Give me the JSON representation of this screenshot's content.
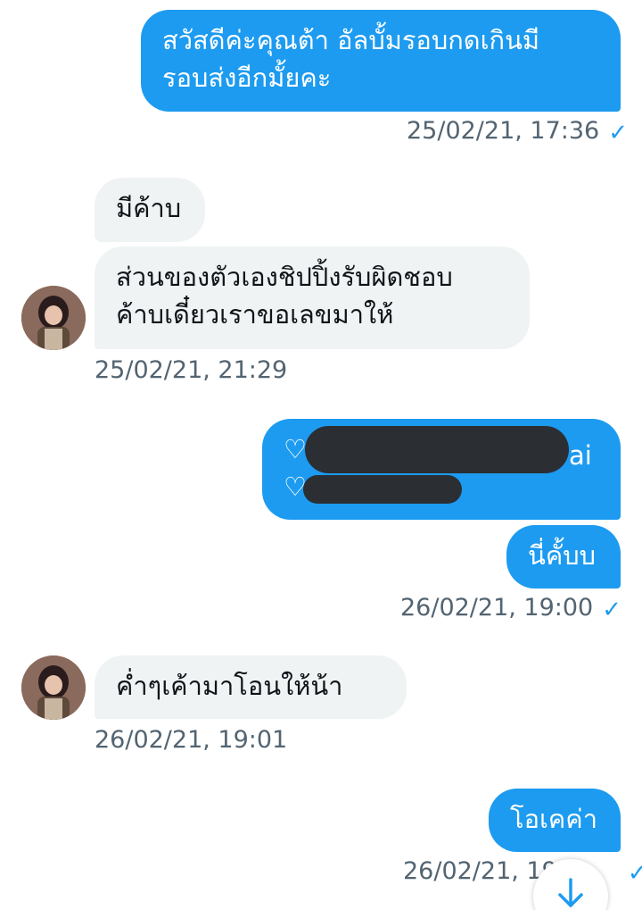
{
  "messages": [
    {
      "lines": [
        "สวัสดีค่ะคุณต้า อัลบั้มรอบกดเกินมี",
        "รอบส่งอีกมั้ยคะ"
      ],
      "meta": "25/02/21, 17:36"
    },
    {
      "lines": [
        "มีค้าบ"
      ]
    },
    {
      "lines": [
        "ส่วนของตัวเองชิปปิ้งรับผิดชอบ",
        "ค้าบเดี๋ยวเราขอเลขมาให้"
      ],
      "meta": "25/02/21, 21:29"
    },
    {
      "lines": [
        "♡",
        "♡"
      ],
      "tail": "ai"
    },
    {
      "lines": [
        "นี่คั้บบ"
      ],
      "meta": "26/02/21, 19:00"
    },
    {
      "lines": [
        "ค่ำๆเค้ามาโอนให้น้า"
      ],
      "meta": "26/02/21, 19:01"
    },
    {
      "lines": [
        "โอเคค่า"
      ],
      "meta": "26/02/21, 19:"
    }
  ],
  "icons": {
    "read_check": "check-icon",
    "scroll_down": "arrow-down-icon"
  },
  "colors": {
    "outgoing_bubble": "#1d9bf0",
    "incoming_bubble": "#eff3f4",
    "timestamp": "#536471",
    "redaction": "#2b2f33"
  }
}
